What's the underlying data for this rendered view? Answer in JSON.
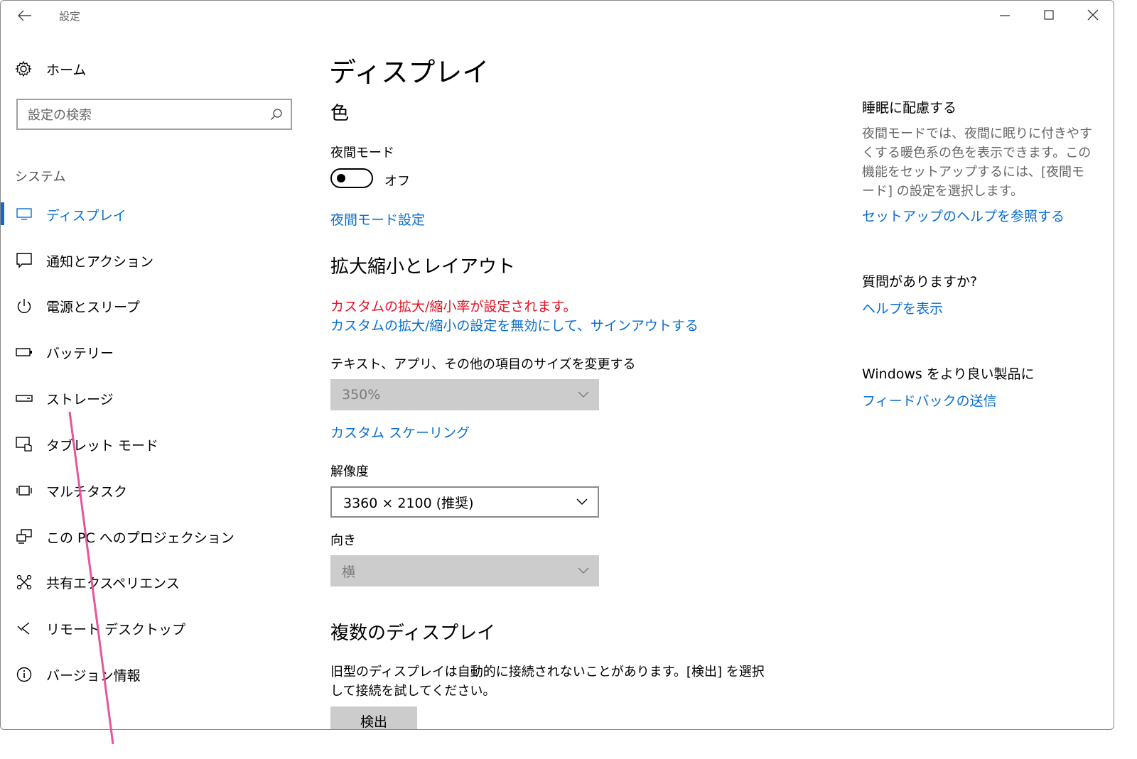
{
  "window": {
    "title": "設定"
  },
  "nav": {
    "home_label": "ホーム",
    "search_placeholder": "設定の検索",
    "section_label": "システム",
    "items": [
      {
        "label": "ディスプレイ",
        "icon": "monitor-icon",
        "active": true
      },
      {
        "label": "通知とアクション",
        "icon": "notification-icon"
      },
      {
        "label": "電源とスリープ",
        "icon": "power-icon"
      },
      {
        "label": "バッテリー",
        "icon": "battery-icon"
      },
      {
        "label": "ストレージ",
        "icon": "storage-icon"
      },
      {
        "label": "タブレット モード",
        "icon": "tablet-mode-icon"
      },
      {
        "label": "マルチタスク",
        "icon": "multitask-icon"
      },
      {
        "label": "この PC へのプロジェクション",
        "icon": "projection-icon"
      },
      {
        "label": "共有エクスペリエンス",
        "icon": "shared-experience-icon"
      },
      {
        "label": "リモート デスクトップ",
        "icon": "remote-desktop-icon"
      },
      {
        "label": "バージョン情報",
        "icon": "info-icon"
      }
    ],
    "accent_color": "#0a6ed1"
  },
  "main": {
    "title": "ディスプレイ",
    "color_section": {
      "heading": "色",
      "night_mode_label": "夜間モード",
      "night_mode_state": "オフ",
      "night_mode_settings_link": "夜間モード設定"
    },
    "scale_section": {
      "heading": "拡大縮小とレイアウト",
      "warning": "カスタムの拡大/縮小率が設定されます。",
      "disable_link": "カスタムの拡大/縮小の設定を無効にして、サインアウトする",
      "size_label": "テキスト、アプリ、その他の項目のサイズを変更する",
      "size_value": "350%",
      "custom_scaling_link": "カスタム スケーリング",
      "resolution_label": "解像度",
      "resolution_value": "3360 × 2100 (推奨)",
      "orientation_label": "向き",
      "orientation_value": "横"
    },
    "multi_display_section": {
      "heading": "複数のディスプレイ",
      "description": "旧型のディスプレイは自動的に接続されないことがあります。[検出] を選択して接続を試してください。",
      "detect_button": "検出"
    }
  },
  "sidebar": {
    "sleep_heading": "睡眠に配慮する",
    "sleep_description": "夜間モードでは、夜間に眠りに付きやすくする暖色系の色を表示できます。この機能をセットアップするには、[夜間モード] の設定を選択します。",
    "setup_help_link": "セットアップのヘルプを参照する",
    "question_heading": "質問がありますか?",
    "help_link": "ヘルプを表示",
    "feedback_heading": "Windows をより良い製品に",
    "feedback_link": "フィードバックの送信"
  },
  "colors": {
    "link": "#0a6ed1",
    "warning": "#e81123",
    "annotation_line": "#e8559a"
  }
}
